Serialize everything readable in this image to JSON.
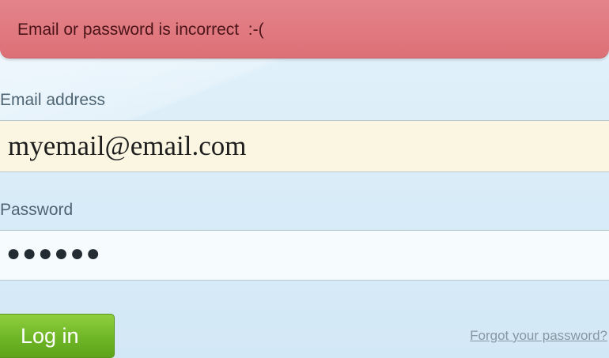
{
  "alert": {
    "message": "Email or password is incorrect  :-("
  },
  "form": {
    "email_label": "Email address",
    "email_value": "myemail@email.com",
    "password_label": "Password",
    "password_value": "●●●●●●",
    "login_label": "Log in",
    "forgot_label": "Forgot your password?"
  },
  "colors": {
    "alert_background": "#e07a81",
    "login_button": "#6fb626",
    "email_field_background": "#fbf6e2",
    "page_background": "#ddeef9"
  }
}
